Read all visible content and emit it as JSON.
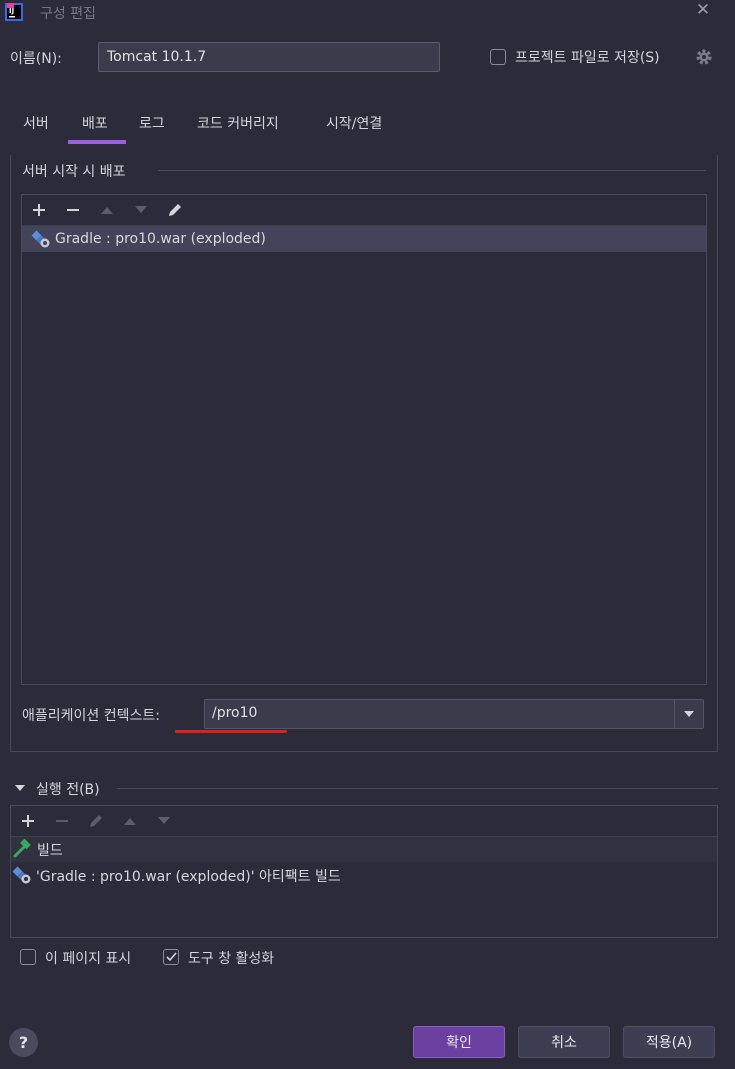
{
  "window": {
    "title": "구성 편집"
  },
  "name_row": {
    "label": "이름(N):",
    "value": "Tomcat 10.1.7",
    "save_to_project_label": "프로젝트 파일로 저장(S)"
  },
  "tabs": [
    {
      "label": "서버"
    },
    {
      "label": "배포"
    },
    {
      "label": "로그"
    },
    {
      "label": "코드 커버리지"
    },
    {
      "label": "시작/연결"
    }
  ],
  "deploy": {
    "group_title": "서버 시작 시 배포",
    "items": [
      {
        "label": "Gradle : pro10.war (exploded)",
        "icon": "artifact-icon"
      }
    ],
    "context_label": "애플리케이션 컨텍스트:",
    "context_value": "/pro10"
  },
  "before_launch": {
    "title": "실행 전(B)",
    "items": [
      {
        "label": "빌드",
        "icon": "hammer-icon"
      },
      {
        "label": "'Gradle : pro10.war (exploded)' 아티팩트 빌드",
        "icon": "artifact-icon"
      }
    ]
  },
  "options": {
    "show_page_label": "이 페이지 표시",
    "show_page_checked": false,
    "activate_tool_label": "도구 창 활성화",
    "activate_tool_checked": true
  },
  "buttons": {
    "help": "?",
    "ok": "확인",
    "cancel": "취소",
    "apply": "적용(A)"
  },
  "colors": {
    "accent": "#9b5fe0",
    "ok_button": "#6a3fa0",
    "highlight_underline": "#e0201f",
    "background": "#2b2b3a"
  }
}
